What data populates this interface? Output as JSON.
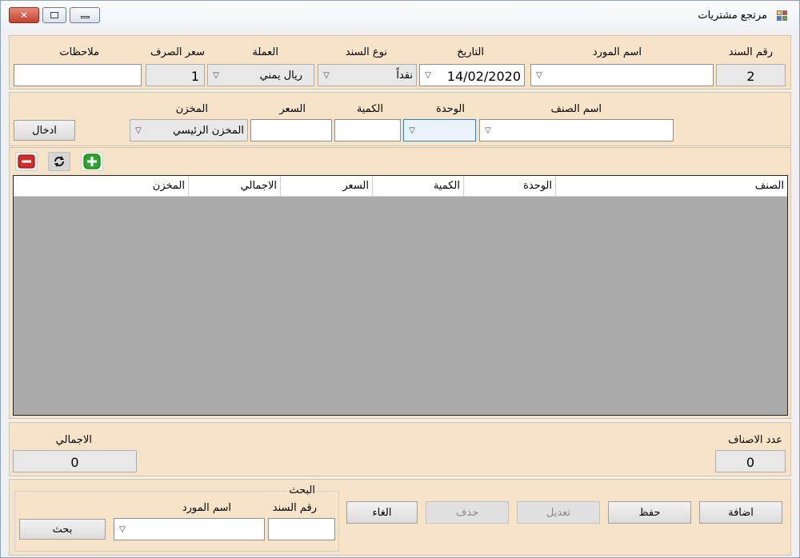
{
  "window": {
    "title": "مرتجع مشتريات"
  },
  "header": {
    "doc_no_label": "رقم السند",
    "doc_no_value": "2",
    "supplier_label": "اسم المورد",
    "supplier_value": "",
    "date_label": "التاريخ",
    "date_value": "14/02/2020",
    "doc_type_label": "نوع السند",
    "doc_type_value": "نقداً",
    "currency_label": "العملة",
    "currency_value": "ريال يمني",
    "rate_label": "سعر الصرف",
    "rate_value": "1",
    "notes_label": "ملاحظات",
    "notes_value": ""
  },
  "entry": {
    "item_label": "اسم الصنف",
    "item_value": "",
    "unit_label": "الوحدة",
    "unit_value": "",
    "qty_label": "الكمية",
    "qty_value": "",
    "price_label": "السعر",
    "price_value": "",
    "store_label": "المخزن",
    "store_value": "المخزن الرئيسي",
    "enter_button": "ادخال"
  },
  "toolbar": {
    "icons": [
      "remove-icon",
      "refresh-icon",
      "add-icon"
    ]
  },
  "grid": {
    "columns": [
      "الصنف",
      "الوحدة",
      "الكمية",
      "السعر",
      "الاجمالي",
      "المخزن"
    ],
    "rows": []
  },
  "summary": {
    "items_count_label": "عدد الاصناف",
    "items_count_value": "0",
    "total_label": "الاجمالي",
    "total_value": "0"
  },
  "actions": {
    "add": "اضافة",
    "save": "حفظ",
    "edit": "تعديل",
    "delete": "حذف",
    "cancel": "الغاء"
  },
  "search": {
    "legend": "البحث",
    "doc_no_label": "رقم السند",
    "doc_no_value": "",
    "supplier_label": "اسم المورد",
    "supplier_value": "",
    "button": "بحث"
  },
  "colors": {
    "panel_bg": "#f7e3c8",
    "grid_bg": "#aaaaaa",
    "close_red": "#c4402b",
    "add_green": "#2fa52f",
    "remove_red": "#d32a2a"
  }
}
